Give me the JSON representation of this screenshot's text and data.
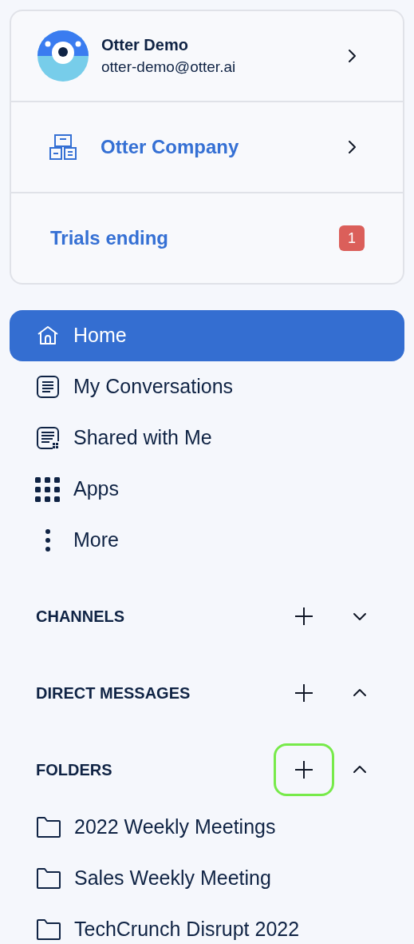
{
  "account": {
    "name": "Otter Demo",
    "email": "otter-demo@otter.ai"
  },
  "workspace": {
    "name": "Otter Company"
  },
  "trials": {
    "label": "Trials ending",
    "count": "1"
  },
  "nav": [
    {
      "kind": "home",
      "label": "Home",
      "selected": true
    },
    {
      "kind": "conversations",
      "label": "My Conversations",
      "selected": false
    },
    {
      "kind": "shared",
      "label": "Shared with Me",
      "selected": false
    },
    {
      "kind": "apps",
      "label": "Apps",
      "selected": false
    },
    {
      "kind": "more",
      "label": "More",
      "selected": false
    }
  ],
  "sections": [
    {
      "title": "CHANNELS",
      "expanded": false,
      "add_highlighted": false
    },
    {
      "title": "DIRECT MESSAGES",
      "expanded": true,
      "add_highlighted": false
    },
    {
      "title": "FOLDERS",
      "expanded": true,
      "add_highlighted": true,
      "items": [
        {
          "label": "2022 Weekly Meetings"
        },
        {
          "label": "Sales Weekly Meeting"
        },
        {
          "label": "TechCrunch Disrupt 2022"
        }
      ]
    }
  ]
}
